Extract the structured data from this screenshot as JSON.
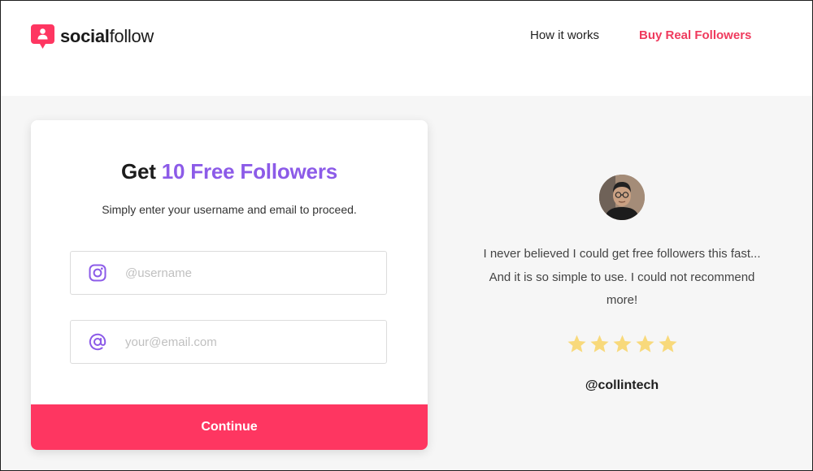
{
  "header": {
    "logo_bold": "social",
    "logo_light": "follow",
    "nav": {
      "how_it_works": "How it works",
      "buy_real_followers": "Buy Real Followers"
    }
  },
  "card": {
    "title_prefix": "Get ",
    "title_accent": "10 Free Followers",
    "subtitle": "Simply enter your username and email to proceed.",
    "username_field": {
      "value": "",
      "placeholder": "@username",
      "icon": "instagram-icon"
    },
    "email_field": {
      "value": "",
      "placeholder": "your@email.com",
      "icon": "at-sign-icon"
    },
    "continue_label": "Continue"
  },
  "testimonial": {
    "quote": "I never believed I could get free followers this fast... And it is so simple to use. I could not recommend more!",
    "rating": 5,
    "rating_max": 5,
    "handle": "@collintech"
  },
  "colors": {
    "brand_pink": "#fe3661",
    "nav_pink": "#ef3a5d",
    "accent_purple": "#8c5be8",
    "star_yellow": "#f8d97b"
  }
}
